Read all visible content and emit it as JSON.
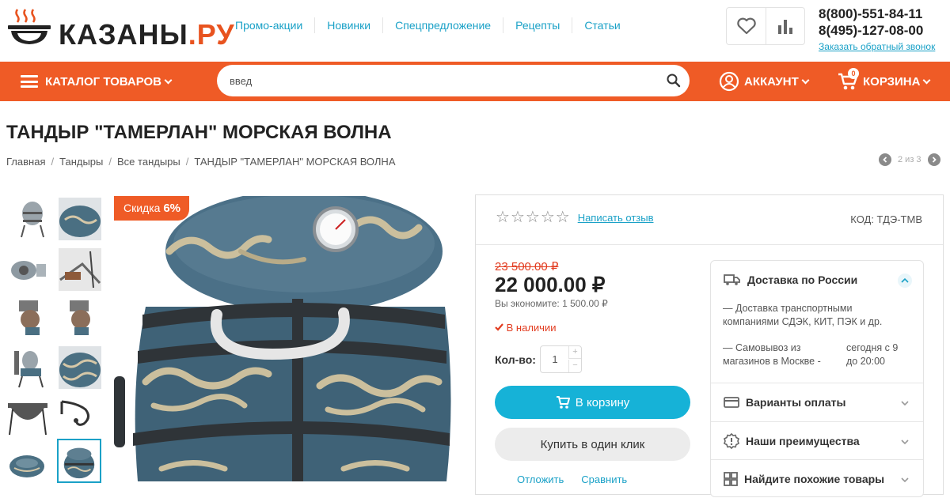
{
  "header": {
    "logo_text": "КАЗАНЫ",
    "logo_suffix": ".РУ",
    "nav": [
      "Промо-акции",
      "Новинки",
      "Спецпредложение",
      "Рецепты",
      "Статьи"
    ],
    "phone1": "8(800)-551-84-11",
    "phone2": "8(495)-127-08-00",
    "callback": "Заказать обратный звонок",
    "favorites_icon": "heart-icon",
    "compare_icon": "bar-chart-icon"
  },
  "bar": {
    "catalog": "КАТАЛОГ ТОВАРОВ",
    "search_value": "введ",
    "account": "АККАУНТ",
    "cart": "КОРЗИНА",
    "cart_count": "0",
    "colors": {
      "brand": "#ef5b26",
      "link": "#1aa1c7",
      "button": "#16b2d7"
    }
  },
  "page": {
    "title": "ТАНДЫР \"ТАМЕРЛАН\" МОРСКАЯ ВОЛНА",
    "breadcrumbs": [
      "Главная",
      "Тандыры",
      "Все тандыры",
      "ТАНДЫР \"ТАМЕРЛАН\" МОРСКАЯ ВОЛНА"
    ],
    "pager": "2 из 3"
  },
  "gallery": {
    "discount_label": "Скидка",
    "discount_value": "6%"
  },
  "product": {
    "stars": "☆",
    "rating_value": 0,
    "review_link": "Написать отзыв",
    "code": "КОД: ТДЭ-ТМВ",
    "old_price": "23 500.00 ₽",
    "price": "22 000.00 ₽",
    "savings": "Вы экономите: 1 500.00 ₽",
    "stock": "В наличии",
    "qty_label": "Кол-во:",
    "qty_value": "1",
    "add_to_cart": "В корзину",
    "one_click": "Купить в один клик",
    "postpone": "Отложить",
    "compare": "Сравнить"
  },
  "delivery": {
    "title": "Доставка по России",
    "line1": "— Доставка транспортными",
    "line2": "компаниями СДЭК, КИТ, ПЭК и др.",
    "pickup1": "— Самовывоз из",
    "pickup2": "магазинов в Москве -",
    "hours1": "сегодня с 9",
    "hours2": "до 20:00",
    "payment": "Варианты оплаты",
    "advantages": "Наши преимущества",
    "similar": "Найдите похожие товары"
  }
}
